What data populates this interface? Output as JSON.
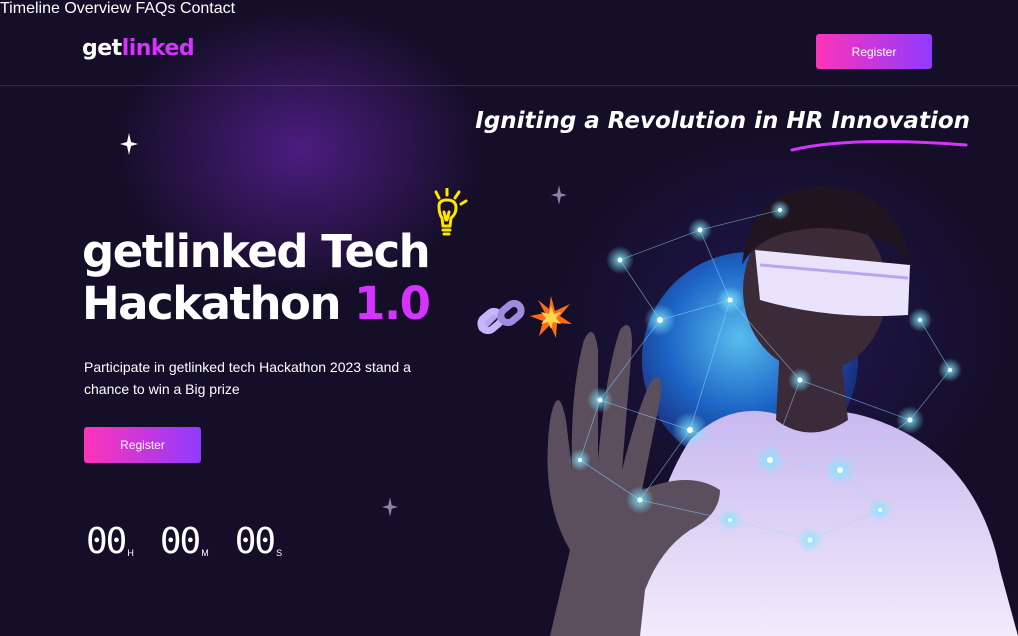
{
  "brand": {
    "part1": "get",
    "part2": "linked"
  },
  "nav": {
    "items": [
      {
        "label": "Timeline"
      },
      {
        "label": "Overview"
      },
      {
        "label": "FAQs"
      },
      {
        "label": "Contact"
      }
    ],
    "register_label": "Register"
  },
  "hero": {
    "tagline": "Igniting a Revolution in HR Innovation",
    "title_line1": "getlinked Tech",
    "title_line2": "Hackathon",
    "title_version": "1.0",
    "description": "Participate in getlinked tech Hackathon 2023 stand a chance to win a Big prize",
    "register_label": "Register",
    "countdown": [
      {
        "value": "00",
        "unit": "H"
      },
      {
        "value": "00",
        "unit": "M"
      },
      {
        "value": "00",
        "unit": "S"
      }
    ]
  },
  "colors": {
    "background": "#150e28",
    "accent_purple": "#d434fe",
    "gradient_start": "#fe34b9",
    "gradient_end": "#903aff"
  },
  "icons": [
    "lightbulb-icon",
    "chain-link-icon",
    "spark-burst-icon",
    "star-sparkle-icon"
  ]
}
